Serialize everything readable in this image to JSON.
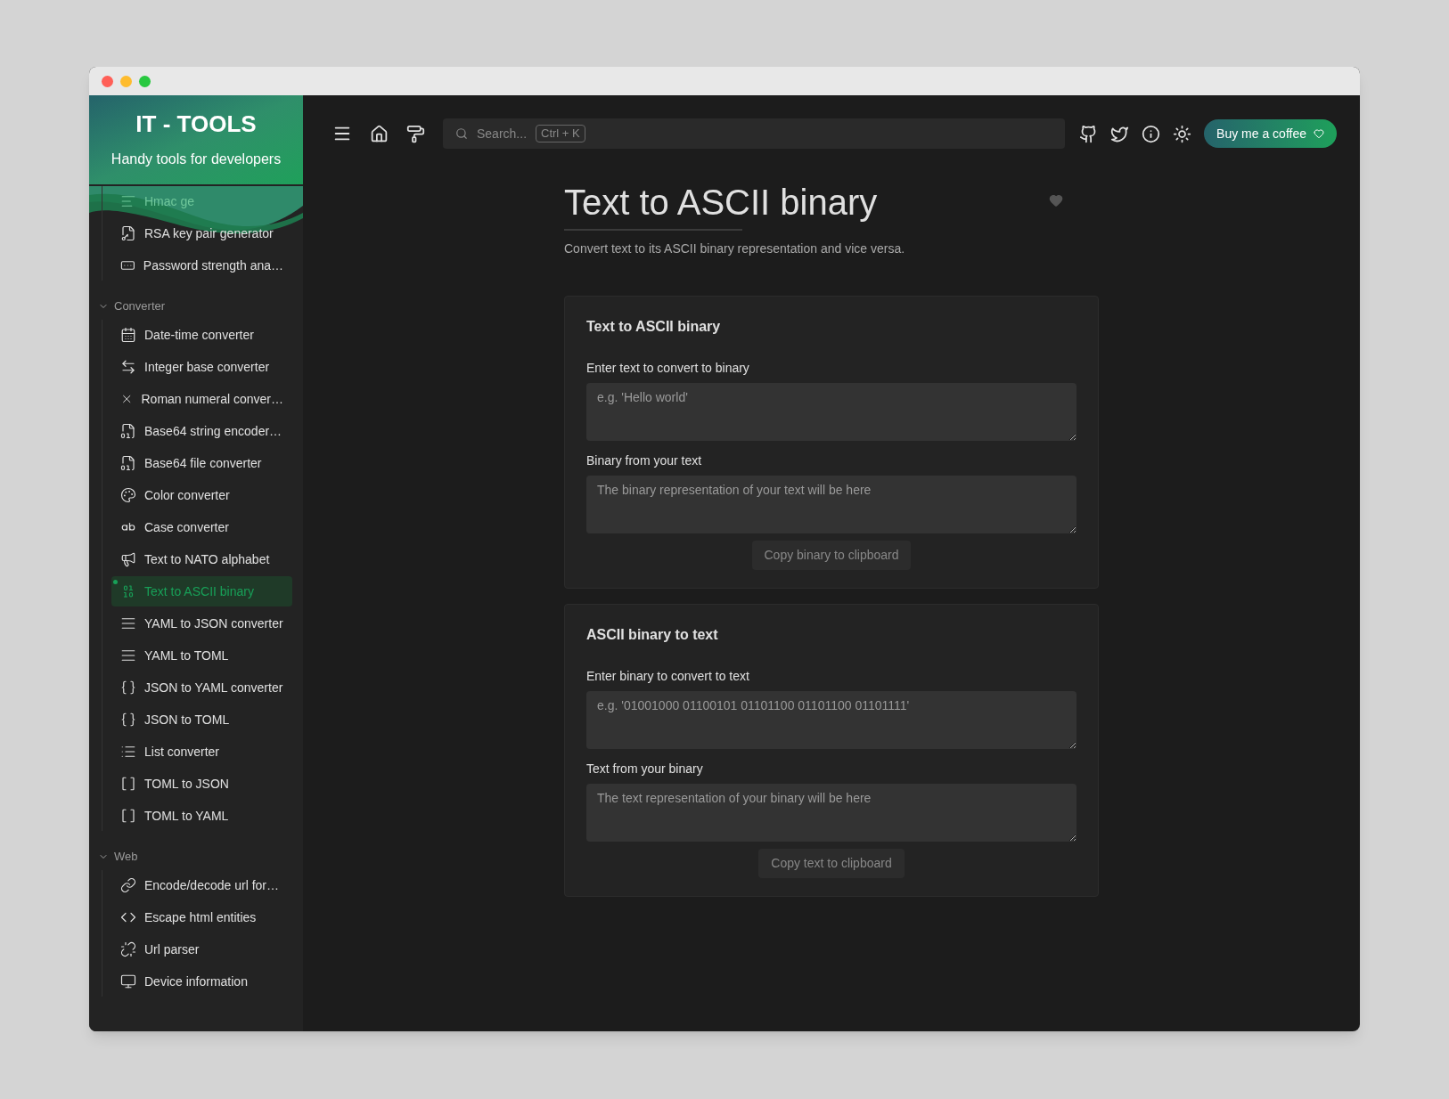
{
  "sidebar": {
    "title": "IT - TOOLS",
    "subtitle": "Handy tools for developers",
    "top_items": [
      {
        "label": "Hmac ge",
        "selected": false
      },
      {
        "label": "RSA key pair generator",
        "selected": false
      },
      {
        "label": "Password strength ana…",
        "selected": false
      }
    ],
    "sections": [
      {
        "label": "Converter",
        "expanded": true,
        "items": [
          {
            "label": "Date-time converter",
            "selected": false
          },
          {
            "label": "Integer base converter",
            "selected": false
          },
          {
            "label": "Roman numeral conver…",
            "selected": false
          },
          {
            "label": "Base64 string encoder…",
            "selected": false
          },
          {
            "label": "Base64 file converter",
            "selected": false
          },
          {
            "label": "Color converter",
            "selected": false
          },
          {
            "label": "Case converter",
            "selected": false
          },
          {
            "label": "Text to NATO alphabet",
            "selected": false
          },
          {
            "label": "Text to ASCII binary",
            "selected": true
          },
          {
            "label": "YAML to JSON converter",
            "selected": false
          },
          {
            "label": "YAML to TOML",
            "selected": false
          },
          {
            "label": "JSON to YAML converter",
            "selected": false
          },
          {
            "label": "JSON to TOML",
            "selected": false
          },
          {
            "label": "List converter",
            "selected": false
          },
          {
            "label": "TOML to JSON",
            "selected": false
          },
          {
            "label": "TOML to YAML",
            "selected": false
          }
        ]
      },
      {
        "label": "Web",
        "expanded": true,
        "items": [
          {
            "label": "Encode/decode url for…",
            "selected": false
          },
          {
            "label": "Escape html entities",
            "selected": false
          },
          {
            "label": "Url parser",
            "selected": false
          },
          {
            "label": "Device information",
            "selected": false
          }
        ]
      }
    ]
  },
  "header": {
    "search": {
      "placeholder": "Search...",
      "shortcut": "Ctrl + K"
    },
    "coffee_button": "Buy me a coffee"
  },
  "page": {
    "title": "Text to ASCII binary",
    "favorite": false,
    "description": "Convert text to its ASCII binary representation and vice versa.",
    "cards": [
      {
        "title": "Text to ASCII binary",
        "fields": [
          {
            "label": "Enter text to convert to binary",
            "placeholder": "e.g. 'Hello world'"
          },
          {
            "label": "Binary from your text",
            "placeholder": "The binary representation of your text will be here"
          }
        ],
        "button": "Copy binary to clipboard"
      },
      {
        "title": "ASCII binary to text",
        "fields": [
          {
            "label": "Enter binary to convert to text",
            "placeholder": "e.g. '01001000 01100101 01101100 01101100 01101111'"
          },
          {
            "label": "Text from your binary",
            "placeholder": "The text representation of your binary will be here"
          }
        ],
        "button": "Copy text to clipboard"
      }
    ]
  }
}
